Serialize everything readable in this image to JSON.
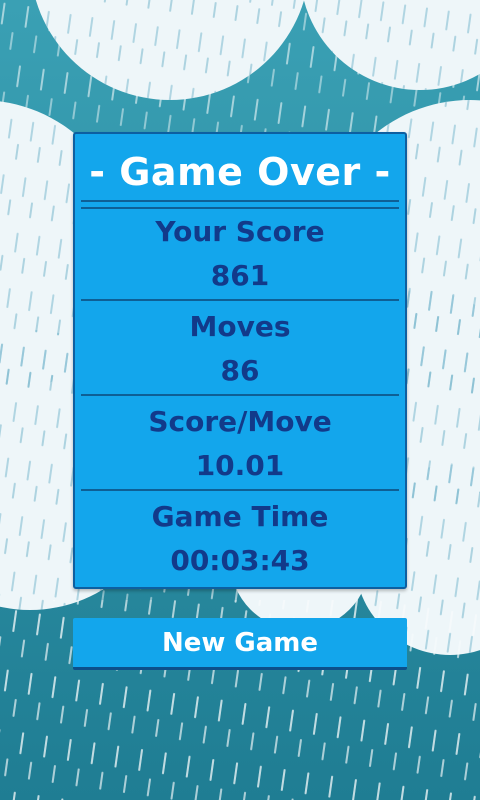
{
  "dialog": {
    "title": "- Game Over -",
    "stats": [
      {
        "label": "Your Score",
        "value": "861"
      },
      {
        "label": "Moves",
        "value": "86"
      },
      {
        "label": "Score/Move",
        "value": "10.01"
      },
      {
        "label": "Game Time",
        "value": "00:03:43"
      }
    ]
  },
  "actions": {
    "new_game_label": "New Game"
  },
  "theme": {
    "panel_color": "#13a6ec",
    "panel_border": "#0d5fa0",
    "title_color": "#ffffff",
    "stat_text_color": "#123a8a",
    "background_water": "#2f8fa6",
    "background_cloud": "#f2f8fa"
  }
}
